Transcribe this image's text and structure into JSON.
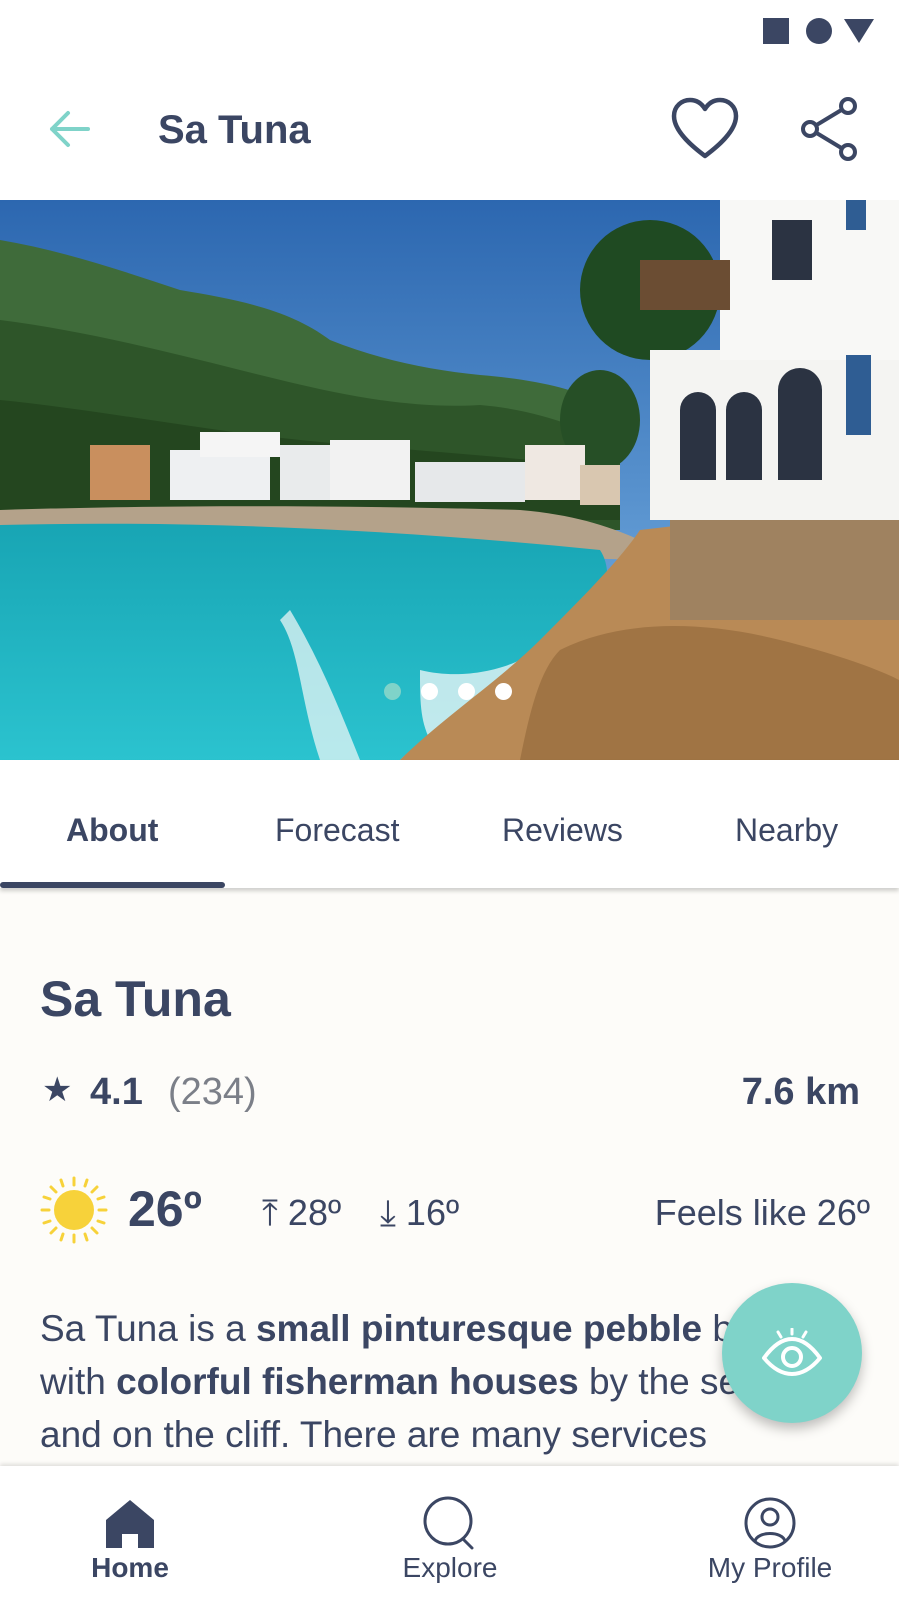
{
  "header": {
    "title": "Sa Tuna"
  },
  "carousel": {
    "total": 4,
    "active_index": 0
  },
  "tabs": [
    {
      "label": "About",
      "active": true
    },
    {
      "label": "Forecast",
      "active": false
    },
    {
      "label": "Reviews",
      "active": false
    },
    {
      "label": "Nearby",
      "active": false
    }
  ],
  "place": {
    "name": "Sa Tuna",
    "rating": "4.1",
    "review_count": "(234)",
    "distance": "7.6 km"
  },
  "weather": {
    "icon": "sun-icon",
    "temperature": "26º",
    "high": "28º",
    "low": "16º",
    "feels_like": "Feels like 26º"
  },
  "description": {
    "p1": "Sa Tuna is a ",
    "b1": "small pinturesque pebble",
    "p2": " beach",
    "p3": "with ",
    "b2": "colorful fisherman houses",
    "p4": " by the sea",
    "p5": "and on the cliff. There are many services"
  },
  "bottom_nav": [
    {
      "label": "Home",
      "icon": "home-icon",
      "active": true
    },
    {
      "label": "Explore",
      "icon": "search-icon",
      "active": false
    },
    {
      "label": "My Profile",
      "icon": "profile-icon",
      "active": false
    }
  ],
  "colors": {
    "primary": "#3b4663",
    "accent": "#7fd3c9",
    "sun": "#f7d23a",
    "background": "#fdfcf9"
  }
}
